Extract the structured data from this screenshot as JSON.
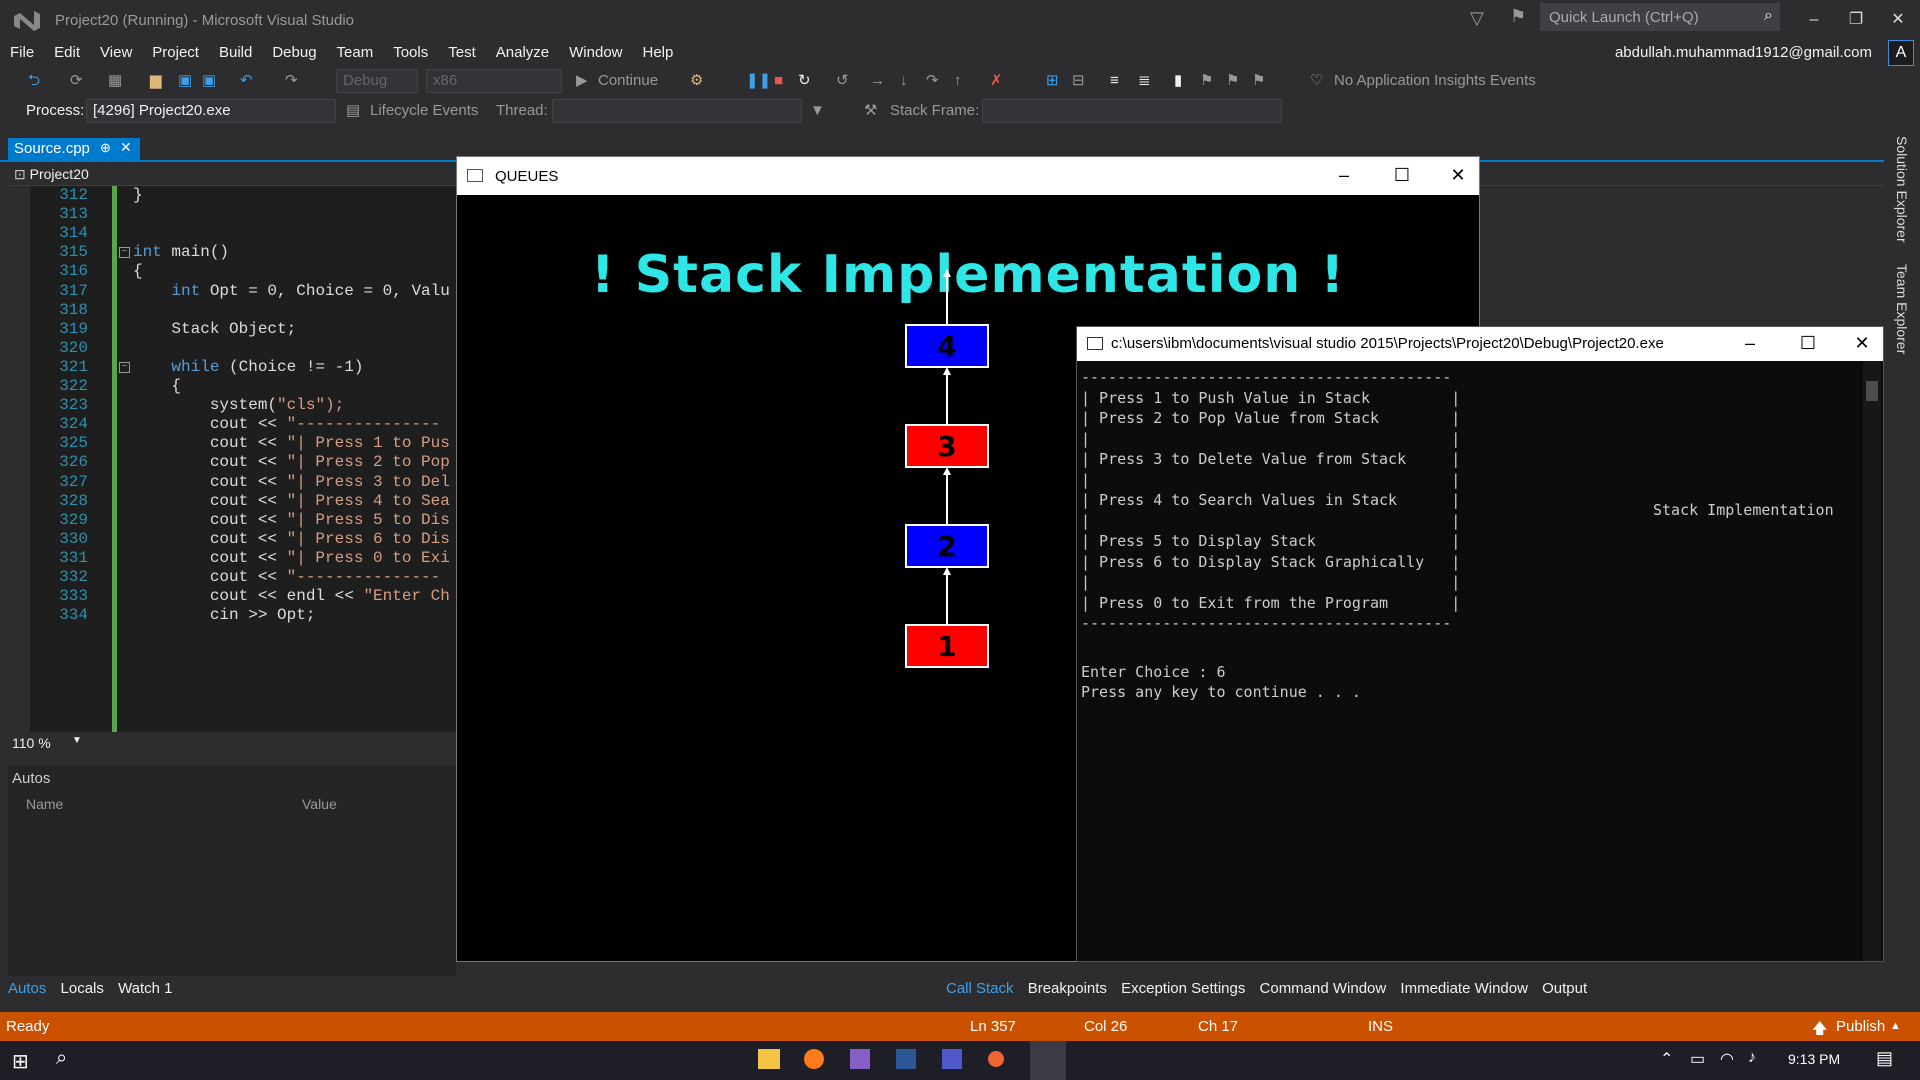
{
  "titlebar": {
    "title": "Project20 (Running) - Microsoft Visual Studio",
    "quick_launch": "Quick Launch (Ctrl+Q)"
  },
  "menu": [
    "File",
    "Edit",
    "View",
    "Project",
    "Build",
    "Debug",
    "Team",
    "Tools",
    "Test",
    "Analyze",
    "Window",
    "Help"
  ],
  "account": "abdullah.muhammad1912@gmail.com",
  "avatar": "A",
  "toolbar": {
    "config": "Debug",
    "platform": "x86",
    "continue": "Continue",
    "insights": "No Application Insights Events"
  },
  "toolbar2": {
    "process_label": "Process:",
    "process_value": "[4296] Project20.exe",
    "lifecycle": "Lifecycle Events",
    "thread_label": "Thread:",
    "stack_frame_label": "Stack Frame:"
  },
  "doc_tab": "Source.cpp",
  "nav_project": "Project20",
  "editor": {
    "lines": [
      {
        "n": "312",
        "t": "}"
      },
      {
        "n": "313",
        "t": ""
      },
      {
        "n": "314",
        "t": ""
      },
      {
        "n": "315",
        "t": "int main()"
      },
      {
        "n": "316",
        "t": "{"
      },
      {
        "n": "317",
        "t": "    int Opt = 0, Choice = 0, Valu"
      },
      {
        "n": "318",
        "t": ""
      },
      {
        "n": "319",
        "t": "    Stack Object;"
      },
      {
        "n": "320",
        "t": ""
      },
      {
        "n": "321",
        "t": "    while (Choice != -1)"
      },
      {
        "n": "322",
        "t": "    {"
      },
      {
        "n": "323",
        "t": "        system(\"cls\");"
      },
      {
        "n": "324",
        "t": "        cout << \"---------------"
      },
      {
        "n": "325",
        "t": "        cout << \"| Press 1 to Pus"
      },
      {
        "n": "326",
        "t": "        cout << \"| Press 2 to Pop"
      },
      {
        "n": "327",
        "t": "        cout << \"| Press 3 to Del"
      },
      {
        "n": "328",
        "t": "        cout << \"| Press 4 to Sea"
      },
      {
        "n": "329",
        "t": "        cout << \"| Press 5 to Dis"
      },
      {
        "n": "330",
        "t": "        cout << \"| Press 6 to Dis"
      },
      {
        "n": "331",
        "t": "        cout << \"| Press 0 to Exi"
      },
      {
        "n": "332",
        "t": "        cout << \"---------------"
      },
      {
        "n": "333",
        "t": "        cout << endl << \"Enter Ch"
      },
      {
        "n": "334",
        "t": "        cin >> Opt;"
      }
    ],
    "zoom": "110 %"
  },
  "autos": {
    "header": "Autos",
    "col_name": "Name",
    "col_value": "Value"
  },
  "bottom_tabs_left": [
    "Autos",
    "Locals",
    "Watch 1"
  ],
  "bottom_tabs_right": [
    "Call Stack",
    "Breakpoints",
    "Exception Settings",
    "Command Window",
    "Immediate Window",
    "Output"
  ],
  "status": {
    "ready": "Ready",
    "ln": "Ln 357",
    "col": "Col 26",
    "ch": "Ch 17",
    "ins": "INS",
    "publish": "Publish"
  },
  "side_panel": [
    "Solution Explorer",
    "Team Explorer"
  ],
  "queues_window": {
    "title": "QUEUES",
    "headline": "! Stack Implementation !",
    "stack": [
      {
        "label": "4",
        "color": "#0000ff"
      },
      {
        "label": "3",
        "color": "#ff0000"
      },
      {
        "label": "2",
        "color": "#0000ff"
      },
      {
        "label": "1",
        "color": "#ff0000"
      }
    ]
  },
  "console": {
    "title": "c:\\users\\ibm\\documents\\visual studio 2015\\Projects\\Project20\\Debug\\Project20.exe",
    "lines": [
      "-----------------------------------------",
      "| Press 1 to Push Value in Stack         |",
      "| Press 2 to Pop Value from Stack        |",
      "|                                        |",
      "| Press 3 to Delete Value from Stack     |",
      "|                                        |",
      "| Press 4 to Search Values in Stack      |",
      "|                                        |",
      "| Press 5 to Display Stack               |",
      "| Press 6 to Display Stack Graphically   |",
      "|                                        |",
      "| Press 0 to Exit from the Program       |",
      "-----------------------------------------",
      "",
      "Enter Choice : 6",
      "Press any key to continue . . ."
    ],
    "right_text": "Stack Implementation"
  },
  "taskbar": {
    "time": "9:13 PM"
  },
  "colors": {
    "accent": "#007acc",
    "status": "#ca5100",
    "headline": "#2ee6e6"
  }
}
